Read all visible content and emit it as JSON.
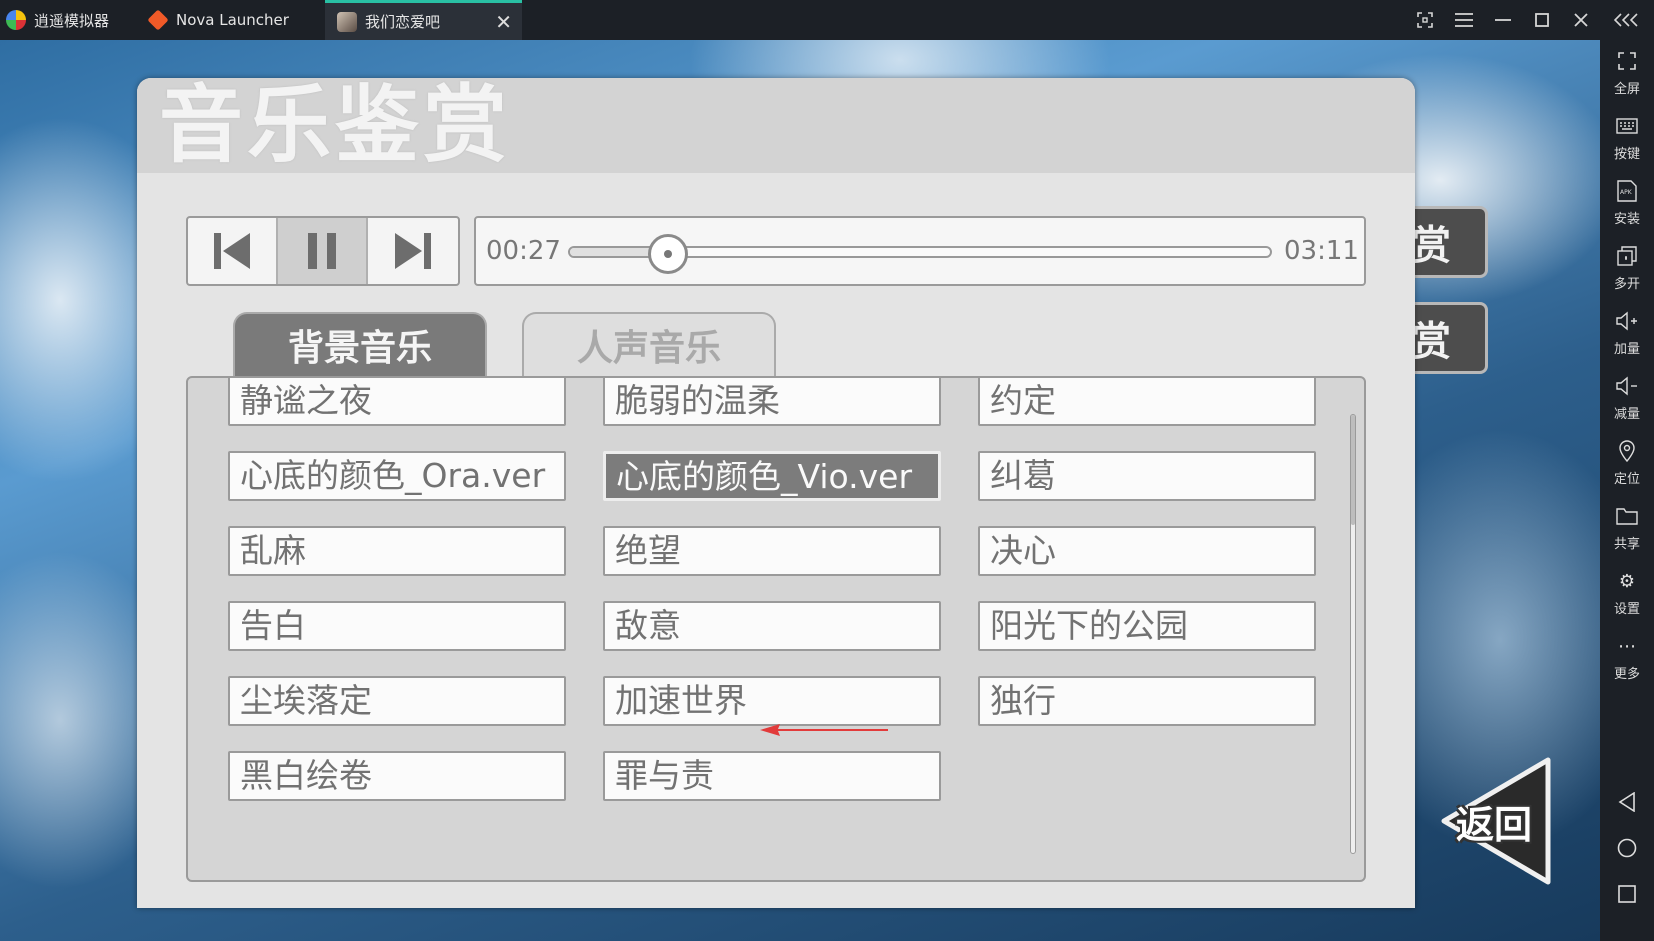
{
  "titlebar": {
    "app_name": "逍遥模拟器",
    "tabs": [
      {
        "label": "Nova Launcher"
      },
      {
        "label": "我们恋爱吧"
      }
    ]
  },
  "sidebar": {
    "items": [
      {
        "label": "全屏",
        "icon": "fullscreen-icon"
      },
      {
        "label": "按键",
        "icon": "keyboard-icon"
      },
      {
        "label": "安装",
        "icon": "apk-install-icon"
      },
      {
        "label": "多开",
        "icon": "multi-instance-icon"
      },
      {
        "label": "加量",
        "icon": "volume-up-icon"
      },
      {
        "label": "减量",
        "icon": "volume-down-icon"
      },
      {
        "label": "定位",
        "icon": "location-icon"
      },
      {
        "label": "共享",
        "icon": "folder-icon"
      },
      {
        "label": "设置",
        "icon": "gear-icon"
      },
      {
        "label": "更多",
        "icon": "more-icon"
      }
    ]
  },
  "game": {
    "title": "音乐鉴赏",
    "side_buttons": [
      "赏",
      "赏"
    ],
    "player": {
      "current_time": "00:27",
      "total_time": "03:11",
      "progress": 0.14
    },
    "tabs": [
      {
        "label": "背景音乐",
        "active": true
      },
      {
        "label": "人声音乐",
        "active": false
      }
    ],
    "songs": [
      {
        "title": "静谧之夜"
      },
      {
        "title": "脆弱的温柔"
      },
      {
        "title": "约定"
      },
      {
        "title": "心底的颜色_Ora.ver"
      },
      {
        "title": "心底的颜色_Vio.ver",
        "selected": true
      },
      {
        "title": "纠葛"
      },
      {
        "title": "乱麻"
      },
      {
        "title": "绝望"
      },
      {
        "title": "决心"
      },
      {
        "title": "告白"
      },
      {
        "title": "敌意"
      },
      {
        "title": "阳光下的公园"
      },
      {
        "title": "尘埃落定"
      },
      {
        "title": "加速世界"
      },
      {
        "title": "独行"
      },
      {
        "title": "黑白绘卷"
      },
      {
        "title": "罪与责"
      }
    ],
    "back_label": "返回",
    "colors": {
      "accent_tab": "#29c0a4",
      "arrow": "#e23b3b"
    }
  }
}
